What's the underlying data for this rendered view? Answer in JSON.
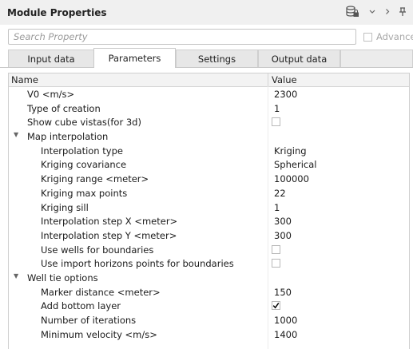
{
  "panel": {
    "title": "Module Properties",
    "toolbar_icons": [
      "database-lock-icon",
      "chevron-down-icon",
      "chevron-right-icon",
      "pin-icon"
    ]
  },
  "search": {
    "placeholder": "Search Property",
    "value": ""
  },
  "advanced": {
    "label": "Advance",
    "checked": false
  },
  "tabs": [
    {
      "label": "Input data",
      "active": false
    },
    {
      "label": "Parameters",
      "active": true
    },
    {
      "label": "Settings",
      "active": false
    },
    {
      "label": "Output data",
      "active": false
    },
    {
      "label": "",
      "active": false
    }
  ],
  "grid": {
    "header": {
      "name": "Name",
      "value": "Value"
    },
    "rows": [
      {
        "type": "prop",
        "level": 1,
        "name": "V0 <m/s>",
        "value": "2300"
      },
      {
        "type": "prop",
        "level": 1,
        "name": "Type of creation",
        "value": "1"
      },
      {
        "type": "check",
        "level": 1,
        "name": "Show cube vistas(for 3d)",
        "checked": false
      },
      {
        "type": "group",
        "level": 0,
        "name": "Map interpolation",
        "expanded": true
      },
      {
        "type": "prop",
        "level": 2,
        "name": "Interpolation type",
        "value": "Kriging"
      },
      {
        "type": "prop",
        "level": 2,
        "name": "Kriging covariance",
        "value": "Spherical"
      },
      {
        "type": "prop",
        "level": 2,
        "name": "Kriging range <meter>",
        "value": "100000"
      },
      {
        "type": "prop",
        "level": 2,
        "name": "Kriging max points",
        "value": "22"
      },
      {
        "type": "prop",
        "level": 2,
        "name": "Kriging sill",
        "value": "1"
      },
      {
        "type": "prop",
        "level": 2,
        "name": "Interpolation step X <meter>",
        "value": "300"
      },
      {
        "type": "prop",
        "level": 2,
        "name": "Interpolation step Y <meter>",
        "value": "300"
      },
      {
        "type": "check",
        "level": 2,
        "name": "Use wells for boundaries",
        "checked": false
      },
      {
        "type": "check",
        "level": 2,
        "name": "Use import horizons points for boundaries",
        "checked": false
      },
      {
        "type": "group",
        "level": 0,
        "name": "Well tie options",
        "expanded": true
      },
      {
        "type": "prop",
        "level": 2,
        "name": "Marker distance <meter>",
        "value": "150"
      },
      {
        "type": "check",
        "level": 2,
        "name": "Add bottom layer",
        "checked": true
      },
      {
        "type": "prop",
        "level": 2,
        "name": "Number of iterations",
        "value": "1000"
      },
      {
        "type": "prop",
        "level": 2,
        "name": "Minimum velocity <m/s>",
        "value": "1400"
      }
    ]
  }
}
